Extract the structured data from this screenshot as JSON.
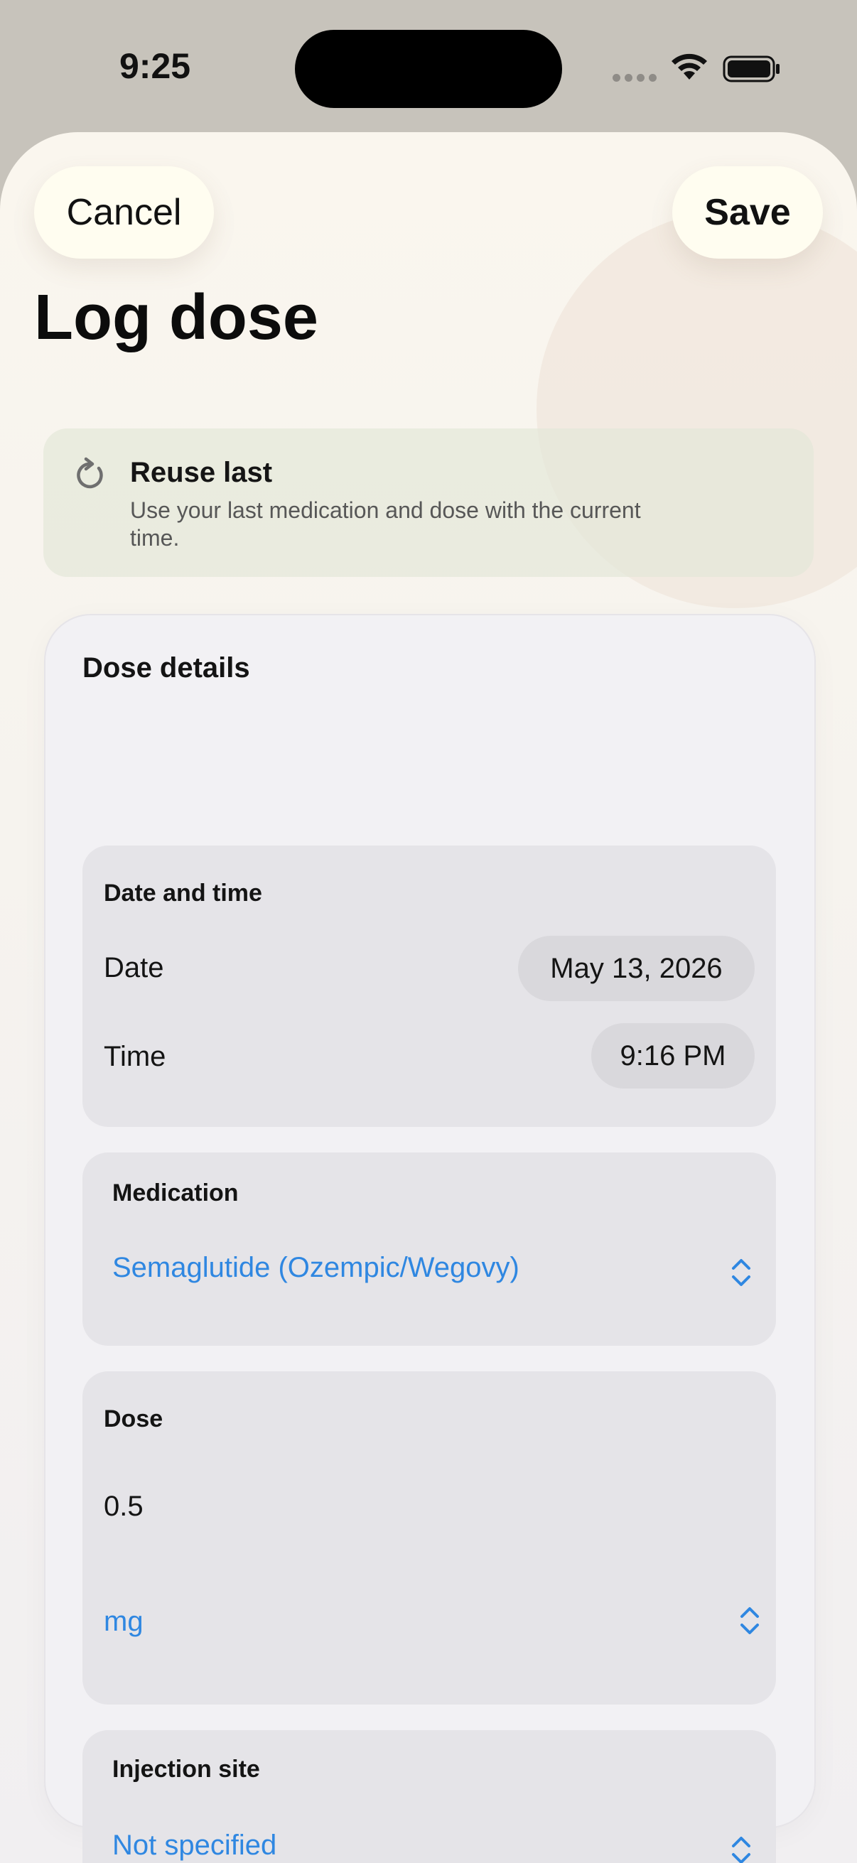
{
  "status_bar": {
    "time": "9:25"
  },
  "header": {
    "cancel_label": "Cancel",
    "save_label": "Save",
    "title": "Log dose"
  },
  "reuse": {
    "title": "Reuse last",
    "description": "Use your last medication and dose with the current time.",
    "icon": "refresh-icon"
  },
  "details": {
    "title": "Dose details",
    "date_time": {
      "label": "Date and time",
      "date_label": "Date",
      "date_value": "May 13, 2026",
      "time_label": "Time",
      "time_value": "9:16 PM"
    },
    "medication": {
      "label": "Medication",
      "value": "Semaglutide (Ozempic/Wegovy)"
    },
    "dose": {
      "label": "Dose",
      "amount": "0.5",
      "unit": "mg"
    },
    "injection_site": {
      "label": "Injection site",
      "value": "Not specified"
    }
  },
  "colors": {
    "accent": "#2f87e1",
    "sheet_background": "#f6f3ee",
    "card_background": "#f2f1f4",
    "group_background": "#e5e4e8"
  }
}
